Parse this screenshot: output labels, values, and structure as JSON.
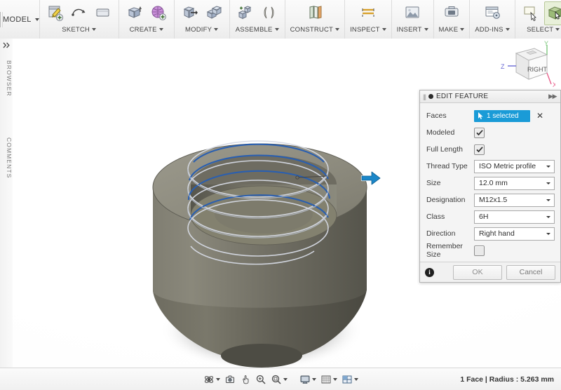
{
  "app": {
    "tab_label": "MODEL"
  },
  "ribbon": {
    "groups": [
      {
        "label": "SKETCH",
        "icons": [
          "create-sketch-icon",
          "sketch-line-icon",
          "sketch-rectangle-icon"
        ]
      },
      {
        "label": "CREATE",
        "icons": [
          "extrude-icon",
          "mesh-body-icon"
        ]
      },
      {
        "label": "MODIFY",
        "icons": [
          "press-pull-icon",
          "combine-icon"
        ]
      },
      {
        "label": "ASSEMBLE",
        "icons": [
          "new-component-icon",
          "joint-icon"
        ]
      },
      {
        "label": "CONSTRUCT",
        "icons": [
          "offset-plane-icon"
        ]
      },
      {
        "label": "INSPECT",
        "icons": [
          "measure-icon"
        ]
      },
      {
        "label": "INSERT",
        "icons": [
          "insert-image-icon"
        ]
      },
      {
        "label": "MAKE",
        "icons": [
          "3d-print-icon"
        ]
      },
      {
        "label": "ADD-INS",
        "icons": [
          "scripts-addins-icon"
        ]
      },
      {
        "label": "SELECT",
        "icons": [
          "select-window-icon",
          "select-cube-icon"
        ]
      }
    ]
  },
  "sidebar": {
    "expand_icon": "expand-panel-icon",
    "browser_label": "BROWSER",
    "comments_label": "COMMENTS"
  },
  "viewcube": {
    "face_label": "RIGHT",
    "axis_x": "X",
    "axis_y": "Y",
    "axis_z": "Z",
    "axis_x_color": "#e8608c",
    "axis_y_color": "#7ec87e",
    "axis_z_color": "#6a6ad4"
  },
  "model": {
    "body_color": "#6b6a5f",
    "top_face_color": "#8d8b7e",
    "thread_highlight_color": "#2a5fb0",
    "thread_line_color": "#c9d0de",
    "shadow_color": "#dcdcdc",
    "manipulator_icon": "arrow-handle-icon",
    "manipulator_color": "#1b87c9"
  },
  "dialog": {
    "grip_icon": "drag-grip-icon",
    "status_icon": "feature-status-icon",
    "title": "EDIT FEATURE",
    "collapse_icon": "collapse-panel-icon",
    "rows": {
      "faces": {
        "label": "Faces",
        "cursor_icon": "select-cursor-icon",
        "value": "1 selected",
        "clear_icon": "clear-selection-icon",
        "clear_glyph": "✕",
        "badge_color": "#1a9bd7"
      },
      "modeled": {
        "label": "Modeled",
        "checked": true,
        "check_glyph": "✓"
      },
      "full_length": {
        "label": "Full Length",
        "checked": true,
        "check_glyph": "✓"
      },
      "thread_type": {
        "label": "Thread Type",
        "value": "ISO Metric profile",
        "dropdown_icon": "chevron-down-icon"
      },
      "size": {
        "label": "Size",
        "value": "12.0 mm",
        "dropdown_icon": "chevron-down-icon"
      },
      "designation": {
        "label": "Designation",
        "value": "M12x1.5",
        "dropdown_icon": "chevron-down-icon"
      },
      "class": {
        "label": "Class",
        "value": "6H",
        "dropdown_icon": "chevron-down-icon"
      },
      "direction": {
        "label": "Direction",
        "value": "Right hand",
        "dropdown_icon": "chevron-down-icon"
      },
      "remember_size": {
        "label": "Remember Size",
        "checked": false
      }
    },
    "footer": {
      "info_icon": "info-icon",
      "info_glyph": "i",
      "ok_label": "OK",
      "cancel_label": "Cancel"
    }
  },
  "bottombar": {
    "tools": [
      {
        "name": "orbit-icon",
        "has_caret": true
      },
      {
        "name": "look-at-icon",
        "has_caret": false
      },
      {
        "name": "pan-icon",
        "has_caret": false
      },
      {
        "name": "zoom-icon",
        "has_caret": false
      },
      {
        "name": "zoom-window-icon",
        "has_caret": true
      },
      {
        "name": "display-mode-icon",
        "has_caret": true
      },
      {
        "name": "grid-snaps-icon",
        "has_caret": true
      },
      {
        "name": "viewports-icon",
        "has_caret": true
      }
    ],
    "status": "1 Face | Radius : 5.263 mm"
  }
}
